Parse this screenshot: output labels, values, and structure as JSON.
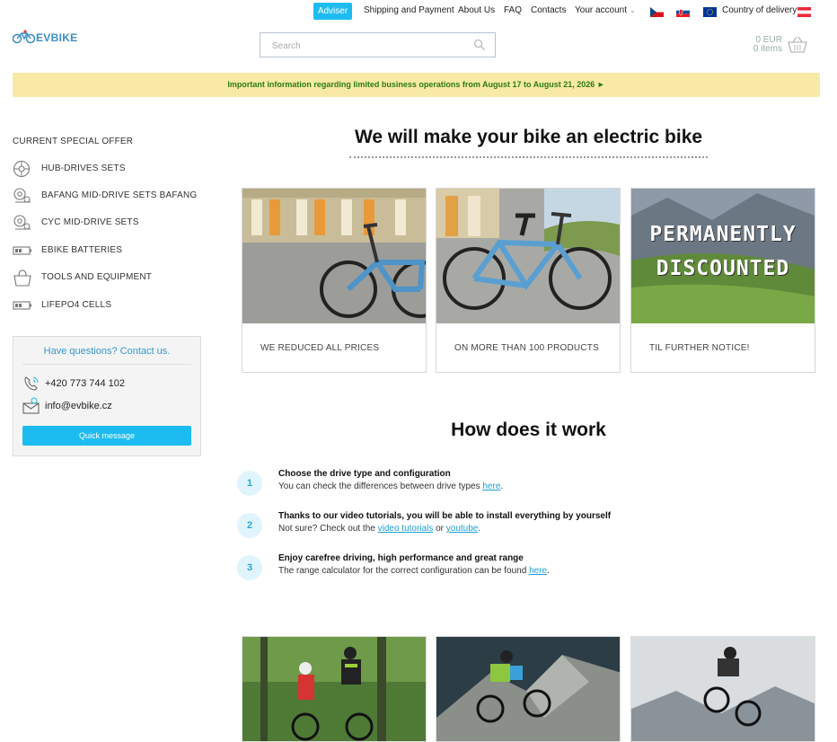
{
  "topbar": {
    "adviser": "Adviser",
    "shipping": "Shipping and Payment",
    "about": "About Us",
    "faq": "FAQ",
    "contacts": "Contacts",
    "account": "Your account",
    "country": "Country of delivery"
  },
  "header": {
    "logo_text": "EVBIKE",
    "search_placeholder": "Search",
    "cart_price": "0 EUR",
    "cart_items": "0 items"
  },
  "banner": "Important information regarding limited business operations from August 17 to August 21, 2026 ►",
  "sidebar": {
    "offer": "CURRENT SPECIAL OFFER",
    "items": [
      {
        "label": "HUB-DRIVES SETS",
        "icon": "hub-wheel-icon"
      },
      {
        "label": "BAFANG MID-DRIVE SETS BAFANG",
        "icon": "mid-drive-icon"
      },
      {
        "label": "CYC MID-DRIVE SETS",
        "icon": "mid-drive-icon"
      },
      {
        "label": "EBIKE BATTERIES",
        "icon": "battery-icon"
      },
      {
        "label": "TOOLS AND EQUIPMENT",
        "icon": "bag-icon"
      },
      {
        "label": "LIFEPO4 CELLS",
        "icon": "battery-icon"
      }
    ],
    "contact": {
      "title": "Have questions? Contact us.",
      "phone": "+420 773 744 102",
      "email": "info@evbike.cz",
      "button": "Quick message"
    }
  },
  "main": {
    "title": "We will make your bike an electric bike",
    "cards": [
      {
        "caption": "WE REDUCED ALL PRICES"
      },
      {
        "caption": "ON MORE THAN 100 PRODUCTS"
      },
      {
        "caption": "TIL FURTHER NOTICE!",
        "overlay_line1": "PERMANENTLY",
        "overlay_line2": "DISCOUNTED"
      }
    ],
    "how_title": "How does it work",
    "steps": [
      {
        "num": "1",
        "title": "Choose the drive type and configuration",
        "text_before": "You can check the differences between drive types ",
        "link1": "here",
        "text_mid": "",
        "link2": "",
        "text_after": "."
      },
      {
        "num": "2",
        "title": "Thanks to our video tutorials, you will be able to install everything by yourself",
        "text_before": "Not sure? Check out the ",
        "link1": "video tutorials",
        "text_mid": " or ",
        "link2": "youtube",
        "text_after": "."
      },
      {
        "num": "3",
        "title": "Enjoy carefree driving, high performance and great range",
        "text_before": "The range calculator for the correct configuration can be found ",
        "link1": "here",
        "text_mid": "",
        "link2": "",
        "text_after": "."
      }
    ]
  },
  "colors": {
    "accent": "#1dbcf0",
    "banner_bg": "#f8e9a6",
    "banner_text": "#2a7d10",
    "link": "#1a9fd8"
  }
}
